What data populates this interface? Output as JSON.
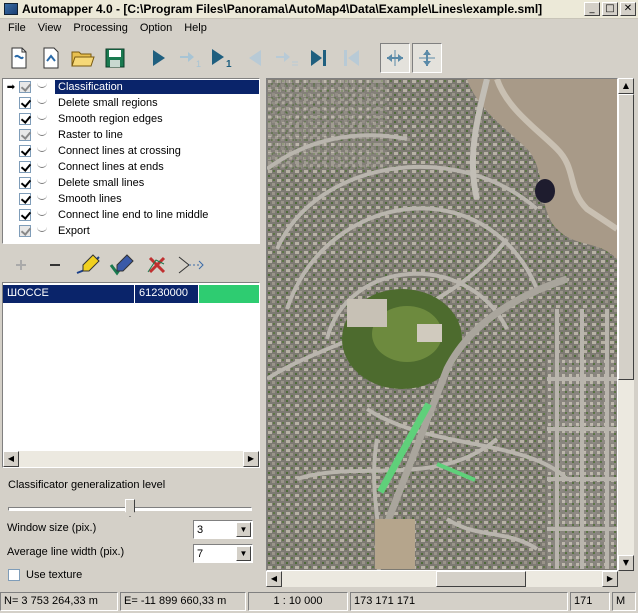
{
  "window": {
    "title": "Automapper 4.0 - [C:\\Program Files\\Panorama\\AutoMap4\\Data\\Example\\Lines\\example.sml]",
    "minimize": "_",
    "maximize": "□",
    "close": "✕"
  },
  "menu": [
    "File",
    "View",
    "Processing",
    "Option",
    "Help"
  ],
  "toolbar": {
    "icons": [
      "new-document-icon",
      "open-document-icon",
      "open-folder-icon",
      "save-disk-icon",
      "play-icon",
      "step-forward-1-icon",
      "play-step-1-icon",
      "step-back-icon",
      "step-forward-list-icon",
      "play-to-end-icon",
      "skip-to-start-icon",
      "horizontal-arrows-icon",
      "vertical-arrows-icon"
    ],
    "step_label_1": "1",
    "step_label_2": "1"
  },
  "tree": {
    "items": [
      {
        "label": "Classification",
        "checked": true,
        "enabled": false,
        "current": true
      },
      {
        "label": "Delete small regions",
        "checked": true,
        "enabled": true
      },
      {
        "label": "Smooth region edges",
        "checked": true,
        "enabled": true
      },
      {
        "label": "Raster to line",
        "checked": true,
        "enabled": false
      },
      {
        "label": "Connect lines at crossing",
        "checked": true,
        "enabled": true
      },
      {
        "label": "Connect lines at ends",
        "checked": true,
        "enabled": true
      },
      {
        "label": "Delete small lines",
        "checked": true,
        "enabled": true
      },
      {
        "label": "Smooth lines",
        "checked": true,
        "enabled": true
      },
      {
        "label": "Connect line end to line middle",
        "checked": true,
        "enabled": true
      },
      {
        "label": "Export",
        "checked": true,
        "enabled": false
      }
    ],
    "current_marker": "➡"
  },
  "list": {
    "rows": [
      {
        "name": "ШОССЕ",
        "code": "61230000",
        "color": "#2ecc71"
      }
    ]
  },
  "scroll": {
    "left": "◀",
    "right": "▶",
    "up": "▲",
    "down": "▼"
  },
  "settings": {
    "gen_label": "Classificator generalization level",
    "gen_level": 0.5,
    "window_size_label": "Window size (pix.)",
    "window_size_value": "3",
    "line_width_label": "Average line width (pix.)",
    "line_width_value": "7",
    "texture_label": "Use texture",
    "texture_checked": false
  },
  "status": {
    "n": "N= 3 753 264,33 m",
    "e": "E= -11 899 660,33 m",
    "scale": "1 : 10 000",
    "color": "173 171 171",
    "zoom": "171",
    "mode": "М"
  }
}
